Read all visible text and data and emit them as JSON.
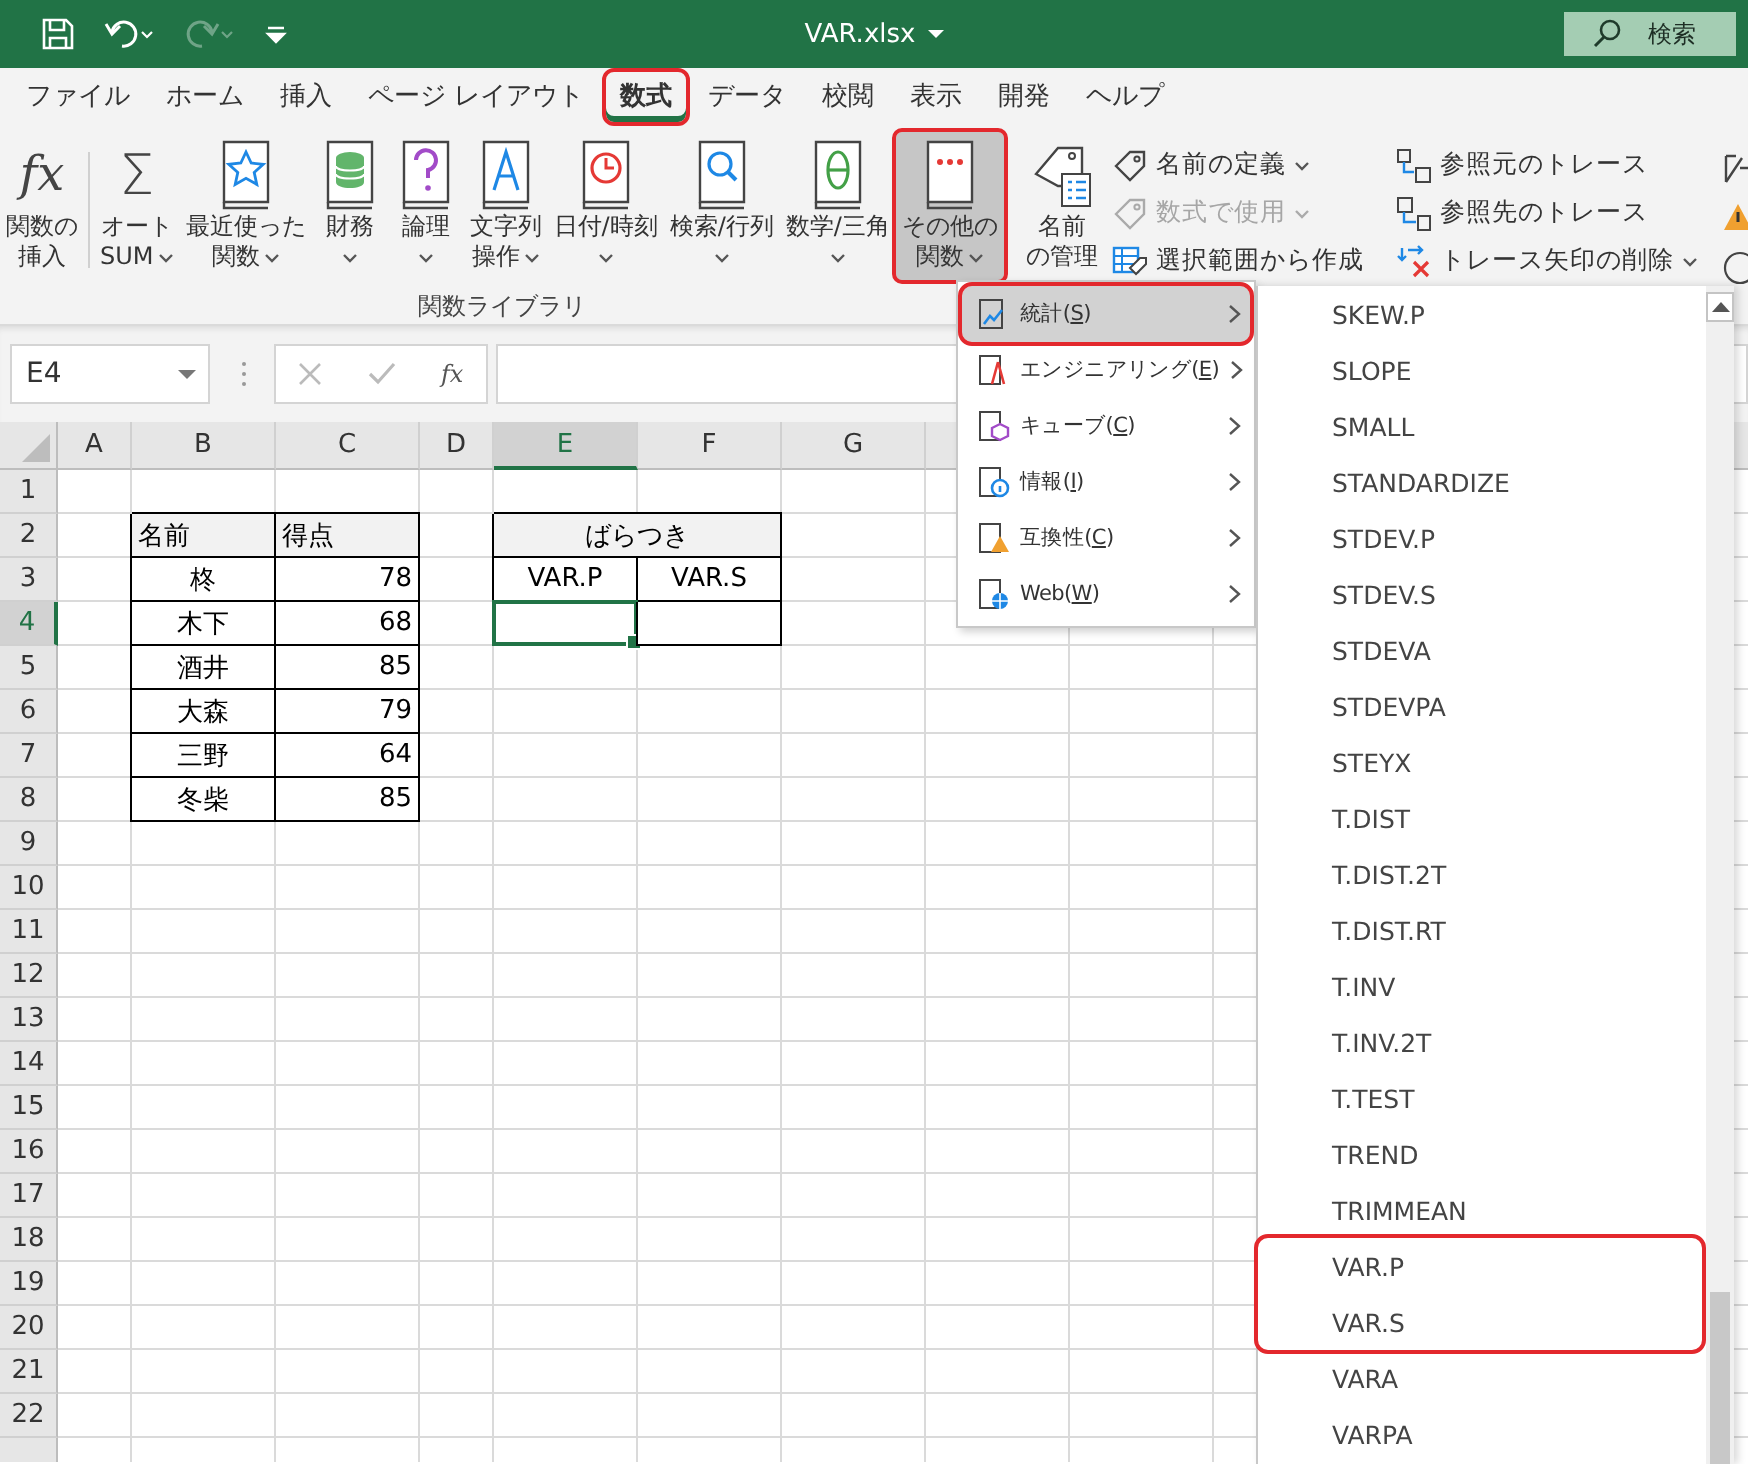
{
  "window": {
    "title": "VAR.xlsx",
    "search": {
      "placeholder": "検索"
    }
  },
  "tabs": [
    {
      "label": "ファイル",
      "selected": false,
      "annotated": false
    },
    {
      "label": "ホーム",
      "selected": false,
      "annotated": false
    },
    {
      "label": "挿入",
      "selected": false,
      "annotated": false
    },
    {
      "label": "ページ レイアウト",
      "selected": false,
      "annotated": false
    },
    {
      "label": "数式",
      "selected": true,
      "annotated": true
    },
    {
      "label": "データ",
      "selected": false,
      "annotated": false
    },
    {
      "label": "校閲",
      "selected": false,
      "annotated": false
    },
    {
      "label": "表示",
      "selected": false,
      "annotated": false
    },
    {
      "label": "開発",
      "selected": false,
      "annotated": false
    },
    {
      "label": "ヘルプ",
      "selected": false,
      "annotated": false
    }
  ],
  "ribbon": {
    "function_library": {
      "label": "関数ライブラリ",
      "buttons": [
        {
          "lines": [
            "関数の",
            "挿入"
          ],
          "glyph": "fx",
          "dropdown": false,
          "pressed": false,
          "annotated": false
        },
        {
          "lines": [
            "オート",
            "SUM"
          ],
          "glyph": "Σ",
          "dropdown": true,
          "pressed": false,
          "annotated": false
        },
        {
          "lines": [
            "最近使った",
            "関数"
          ],
          "dropdown": true,
          "pressed": false,
          "annotated": false
        },
        {
          "lines": [
            "財務"
          ],
          "dropdown": true,
          "pressed": false,
          "annotated": false
        },
        {
          "lines": [
            "論理"
          ],
          "dropdown": true,
          "pressed": false,
          "annotated": false
        },
        {
          "lines": [
            "文字列",
            "操作"
          ],
          "dropdown": true,
          "pressed": false,
          "annotated": false
        },
        {
          "lines": [
            "日付/時刻"
          ],
          "dropdown": true,
          "pressed": false,
          "annotated": false
        },
        {
          "lines": [
            "検索/行列"
          ],
          "dropdown": true,
          "pressed": false,
          "annotated": false
        },
        {
          "lines": [
            "数学/三角"
          ],
          "dropdown": true,
          "pressed": false,
          "annotated": false
        },
        {
          "lines": [
            "その他の",
            "関数"
          ],
          "dropdown": true,
          "pressed": true,
          "annotated": true
        }
      ]
    },
    "defined_names": {
      "big_button": {
        "lines": [
          "名前",
          "の管理"
        ]
      },
      "small_buttons": [
        {
          "label": "名前の定義",
          "dropdown": true,
          "disabled": false
        },
        {
          "label": "数式で使用",
          "dropdown": true,
          "disabled": true
        },
        {
          "label": "選択範囲から作成",
          "dropdown": false,
          "disabled": false
        }
      ]
    },
    "formula_auditing": {
      "small_buttons": [
        {
          "label": "参照元のトレース",
          "dropdown": false,
          "disabled": false
        },
        {
          "label": "参照先のトレース",
          "dropdown": false,
          "disabled": false
        },
        {
          "label": "トレース矢印の削除",
          "dropdown": true,
          "disabled": false
        }
      ]
    }
  },
  "formula_bar": {
    "name_box": "E4",
    "fx": "fx"
  },
  "sheet": {
    "columns": [
      "A",
      "B",
      "C",
      "D",
      "E",
      "F",
      "G"
    ],
    "rows": [
      {
        "header": "1"
      },
      {
        "header": "2",
        "cells": {
          "B": {
            "text": "名前",
            "kind": "label",
            "shaded": true,
            "selected": false
          },
          "C": {
            "text": "得点",
            "kind": "label",
            "shaded": true,
            "selected": false
          },
          "E": {
            "text": "ばらつき",
            "kind": "merged",
            "shaded": true,
            "selected": false
          }
        }
      },
      {
        "header": "3",
        "cells": {
          "B": {
            "text": "柊",
            "kind": "name",
            "shaded": false,
            "selected": false
          },
          "C": {
            "text": "78",
            "kind": "number",
            "shaded": false,
            "selected": false
          },
          "E": {
            "text": "VAR.P",
            "kind": "name",
            "shaded": false,
            "selected": false
          },
          "F": {
            "text": "VAR.S",
            "kind": "name",
            "shaded": false,
            "selected": false
          }
        }
      },
      {
        "header": "4",
        "cells": {
          "B": {
            "text": "木下",
            "kind": "name",
            "shaded": false,
            "selected": false
          },
          "C": {
            "text": "68",
            "kind": "number",
            "shaded": false,
            "selected": false
          },
          "E": {
            "kind": "empty",
            "shaded": false,
            "selected": true
          },
          "F": {
            "kind": "empty",
            "shaded": false,
            "selected": false
          }
        }
      },
      {
        "header": "5",
        "cells": {
          "B": {
            "text": "酒井",
            "kind": "name",
            "shaded": false,
            "selected": false
          },
          "C": {
            "text": "85",
            "kind": "number",
            "shaded": false,
            "selected": false
          }
        }
      },
      {
        "header": "6",
        "cells": {
          "B": {
            "text": "大森",
            "kind": "name",
            "shaded": false,
            "selected": false
          },
          "C": {
            "text": "79",
            "kind": "number",
            "shaded": false,
            "selected": false
          }
        }
      },
      {
        "header": "7",
        "cells": {
          "B": {
            "text": "三野",
            "kind": "name",
            "shaded": false,
            "selected": false
          },
          "C": {
            "text": "64",
            "kind": "number",
            "shaded": false,
            "selected": false
          }
        }
      },
      {
        "header": "8",
        "cells": {
          "B": {
            "text": "冬柴",
            "kind": "name",
            "shaded": false,
            "selected": false
          },
          "C": {
            "text": "85",
            "kind": "number",
            "shaded": false,
            "selected": false
          }
        }
      },
      {
        "header": "9"
      },
      {
        "header": "10"
      },
      {
        "header": "11"
      },
      {
        "header": "12"
      },
      {
        "header": "13"
      },
      {
        "header": "14"
      },
      {
        "header": "15"
      },
      {
        "header": "16"
      },
      {
        "header": "17"
      },
      {
        "header": "18"
      },
      {
        "header": "19"
      },
      {
        "header": "20"
      },
      {
        "header": "21"
      },
      {
        "header": "22"
      }
    ]
  },
  "menu": {
    "items": [
      {
        "before": "統計(",
        "key": "S",
        "after": ")",
        "selected": true,
        "annotated": true
      },
      {
        "before": "エンジニアリング(",
        "key": "E",
        "after": ")",
        "selected": false,
        "annotated": false
      },
      {
        "before": "キューブ(",
        "key": "C",
        "after": ")",
        "selected": false,
        "annotated": false
      },
      {
        "before": "情報(",
        "key": "I",
        "after": ")",
        "selected": false,
        "annotated": false
      },
      {
        "before": "互換性(",
        "key": "C",
        "after": ")",
        "selected": false,
        "annotated": false
      },
      {
        "before": "Web(",
        "key": "W",
        "after": ")",
        "selected": false,
        "annotated": false
      }
    ]
  },
  "submenu": {
    "items": [
      {
        "label": "SKEW.P",
        "annotated": false
      },
      {
        "label": "SLOPE",
        "annotated": false
      },
      {
        "label": "SMALL",
        "annotated": false
      },
      {
        "label": "STANDARDIZE",
        "annotated": false
      },
      {
        "label": "STDEV.P",
        "annotated": false
      },
      {
        "label": "STDEV.S",
        "annotated": false
      },
      {
        "label": "STDEVA",
        "annotated": false
      },
      {
        "label": "STDEVPA",
        "annotated": false
      },
      {
        "label": "STEYX",
        "annotated": false
      },
      {
        "label": "T.DIST",
        "annotated": false
      },
      {
        "label": "T.DIST.2T",
        "annotated": false
      },
      {
        "label": "T.DIST.RT",
        "annotated": false
      },
      {
        "label": "T.INV",
        "annotated": false
      },
      {
        "label": "T.INV.2T",
        "annotated": false
      },
      {
        "label": "T.TEST",
        "annotated": false
      },
      {
        "label": "TREND",
        "annotated": false
      },
      {
        "label": "TRIMMEAN",
        "annotated": false
      },
      {
        "label": "VAR.P",
        "annotated": true
      },
      {
        "label": "VAR.S",
        "annotated": true
      },
      {
        "label": "VARA",
        "annotated": false
      },
      {
        "label": "VARPA",
        "annotated": false
      }
    ]
  }
}
